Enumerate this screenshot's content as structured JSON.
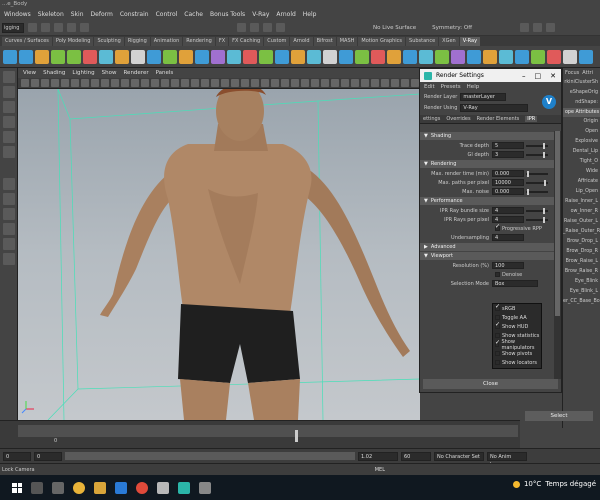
{
  "window": {
    "title": "...e_Body"
  },
  "menubar": [
    "Windows",
    "Skeleton",
    "Skin",
    "Deform",
    "Constrain",
    "Control",
    "Cache",
    "Bonus Tools",
    "V-Ray",
    "Arnold",
    "Help"
  ],
  "status": {
    "mode": "igging",
    "live_surface": "No Live Surface",
    "symmetry": "Symmetry: Off"
  },
  "shelf_tabs": [
    {
      "label": "Curves / Surfaces",
      "active": false
    },
    {
      "label": "Poly Modeling",
      "active": false
    },
    {
      "label": "Sculpting",
      "active": false
    },
    {
      "label": "Rigging",
      "active": false
    },
    {
      "label": "Animation",
      "active": false
    },
    {
      "label": "Rendering",
      "active": false
    },
    {
      "label": "FX",
      "active": false
    },
    {
      "label": "FX Caching",
      "active": false
    },
    {
      "label": "Custom",
      "active": false
    },
    {
      "label": "Arnold",
      "active": false
    },
    {
      "label": "Bifrost",
      "active": false
    },
    {
      "label": "MASH",
      "active": false
    },
    {
      "label": "Motion Graphics",
      "active": false
    },
    {
      "label": "Substance",
      "active": false
    },
    {
      "label": "XGen",
      "active": false
    },
    {
      "label": "V-Ray",
      "active": true
    }
  ],
  "viewport": {
    "menu": [
      "View",
      "Shading",
      "Lighting",
      "Show",
      "Renderer",
      "Panels"
    ],
    "camera_label": "Lock Camera"
  },
  "render_settings": {
    "title": "Render Settings",
    "menu": [
      "Edit",
      "Presets",
      "Help"
    ],
    "render_layer_label": "Render Layer",
    "render_layer_value": "masterLayer",
    "render_using_label": "Render Using",
    "render_using_value": "V-Ray",
    "tabs": [
      {
        "label": "ettings",
        "active": false
      },
      {
        "label": "Overrides",
        "active": false
      },
      {
        "label": "Render Elements",
        "active": false
      },
      {
        "label": "IPR",
        "active": true
      }
    ],
    "sections": {
      "shading": {
        "title": "Shading",
        "fields": [
          {
            "label": "Trace depth",
            "value": "5",
            "knob": 0.85
          },
          {
            "label": "GI depth",
            "value": "3",
            "knob": 0.85
          }
        ]
      },
      "rendering": {
        "title": "Rendering",
        "fields": [
          {
            "label": "Max. render time (min)",
            "value": "0.000",
            "knob": 0.05
          },
          {
            "label": "Max. paths per pixel",
            "value": "10000",
            "knob": 0.9
          },
          {
            "label": "Max. noise",
            "value": "0.000",
            "knob": 0.05
          }
        ]
      },
      "performance": {
        "title": "Performance",
        "fields": [
          {
            "label": "IPR Ray bundle size",
            "value": "4",
            "knob": 0.85
          },
          {
            "label": "IPR Rays per pixel",
            "value": "4",
            "knob": 0.85
          }
        ],
        "checkbox": {
          "label": "Progressive RPP",
          "checked": true
        },
        "undersampling": {
          "label": "Undersampling",
          "value": "4"
        }
      },
      "advanced": {
        "title": "Advanced"
      },
      "viewport": {
        "title": "Viewport",
        "resolution": {
          "label": "Resolution (%)",
          "value": "100"
        },
        "denoise": {
          "label": "Denoise",
          "checked": false
        },
        "selection_mode": {
          "label": "Selection Mode",
          "value": "Box"
        }
      }
    },
    "dropdown_items": [
      {
        "label": "sRGB",
        "checked": true
      },
      {
        "label": "Toggle AA",
        "checked": false
      },
      {
        "label": "Show HUD",
        "checked": true
      },
      {
        "label": "Show statistics",
        "checked": false
      },
      {
        "label": "Show manipulators",
        "checked": true
      },
      {
        "label": "Show pivots",
        "checked": false
      },
      {
        "label": "Show locators",
        "checked": false
      }
    ],
    "close_label": "Close"
  },
  "channel_box": {
    "tabs": [
      "Focus",
      "Attri"
    ],
    "rows": [
      "rkiniClusterSh",
      "eShapeOrig",
      "ndShape:",
      "ope Attributes",
      "Origin",
      "Open",
      "Explosive",
      "Dental_Lip",
      "Tight_O",
      "Wide",
      "Affricate",
      "Lip_Open",
      "Raise_Inner_L",
      "ow_Inner_R",
      "Raise_Outer_L",
      "_Raise_Outer_R",
      "Brow_Drop_L",
      "Brow_Drop_R",
      "Brow_Raise_L",
      "Brow_Raise_R",
      "Eye_Blink",
      "Eye_Blink_L",
      "er_CC_Base_Bo"
    ],
    "select_label": "Select"
  },
  "timeline": {
    "start_value": "0",
    "frame_value": "0",
    "step_value": "1.02",
    "end_value": "60",
    "character_set": "No Character Set",
    "anim_layer": "No Anim Layer"
  },
  "command_line": {
    "label": "Lock Camera",
    "mel": "MEL"
  },
  "taskbar": {
    "weather": "10°C",
    "weather_text": "Temps dégagé"
  },
  "colors": {
    "vray_blue": "#1f80c9",
    "maya_teal": "#2bb5a8",
    "viewport_bg": "#b5bcc2",
    "grid_green": "#47e0b8"
  }
}
